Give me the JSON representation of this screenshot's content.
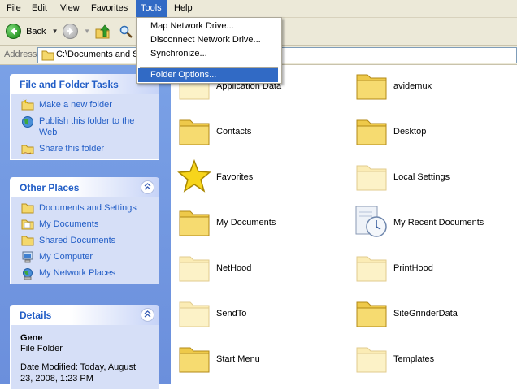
{
  "menu": {
    "items": [
      "File",
      "Edit",
      "View",
      "Favorites",
      "Tools",
      "Help"
    ],
    "active": "Tools"
  },
  "toolbar": {
    "back_label": "Back"
  },
  "address": {
    "label": "Address",
    "value": "C:\\Documents and S"
  },
  "tools_menu": {
    "items": [
      "Map Network Drive...",
      "Disconnect Network Drive...",
      "Synchronize...",
      "Folder Options..."
    ],
    "highlighted": "Folder Options..."
  },
  "task_pane": {
    "file_tasks": {
      "title": "File and Folder Tasks",
      "items": [
        "Make a new folder",
        "Publish this folder to the Web",
        "Share this folder"
      ]
    },
    "other_places": {
      "title": "Other Places",
      "items": [
        "Documents and Settings",
        "My Documents",
        "Shared Documents",
        "My Computer",
        "My Network Places"
      ]
    },
    "details": {
      "title": "Details",
      "name": "Gene",
      "type": "File Folder",
      "modified": "Date Modified: Today, August 23, 2008, 1:23 PM"
    }
  },
  "folders": [
    {
      "label": "Application Data",
      "icon": "folder-icon",
      "faded": true
    },
    {
      "label": "avidemux",
      "icon": "folder-icon",
      "faded": false
    },
    {
      "label": "Contacts",
      "icon": "folder-icon",
      "faded": false
    },
    {
      "label": "Desktop",
      "icon": "folder-icon",
      "faded": false
    },
    {
      "label": "Favorites",
      "icon": "star-icon",
      "faded": false
    },
    {
      "label": "Local Settings",
      "icon": "folder-icon",
      "faded": true
    },
    {
      "label": "My Documents",
      "icon": "folder-icon",
      "faded": false
    },
    {
      "label": "My Recent Documents",
      "icon": "recent-documents-icon",
      "faded": false
    },
    {
      "label": "NetHood",
      "icon": "folder-icon",
      "faded": true
    },
    {
      "label": "PrintHood",
      "icon": "folder-icon",
      "faded": true
    },
    {
      "label": "SendTo",
      "icon": "folder-icon",
      "faded": true
    },
    {
      "label": "SiteGrinderData",
      "icon": "folder-icon",
      "faded": false
    },
    {
      "label": "Start Menu",
      "icon": "folder-icon",
      "faded": false
    },
    {
      "label": "Templates",
      "icon": "folder-icon",
      "faded": true
    }
  ],
  "colors": {
    "selection": "#316ac5",
    "link": "#215dc6",
    "pane": "#6b8fdc"
  }
}
